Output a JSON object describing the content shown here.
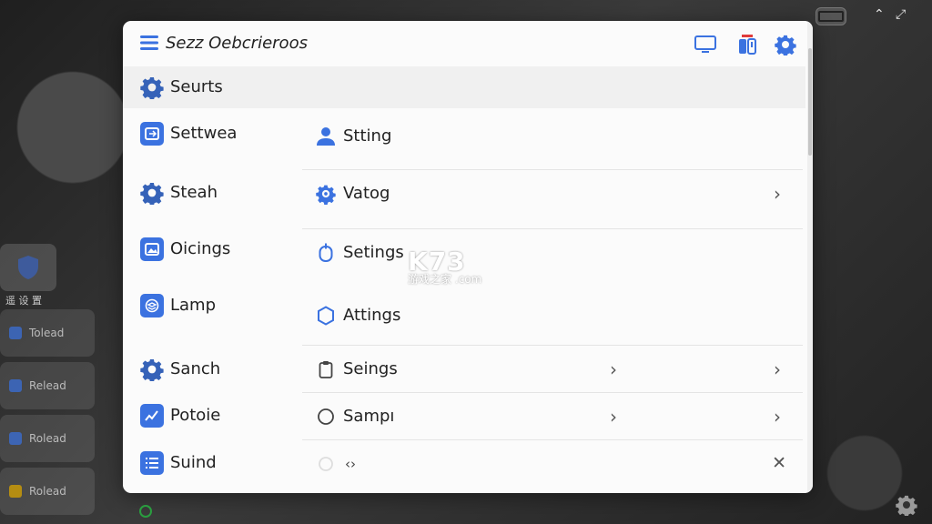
{
  "window": {
    "title": "Sezz Oebcrieroos",
    "section_label": "Seurts"
  },
  "sidebar": {
    "items": [
      {
        "label": "Settwea",
        "icon": "swap-icon"
      },
      {
        "label": "Steah",
        "icon": "gear-icon"
      },
      {
        "label": "Oicings",
        "icon": "image-icon"
      },
      {
        "label": "Lamp",
        "icon": "layers-icon"
      },
      {
        "label": "Sanch",
        "icon": "gear-icon"
      },
      {
        "label": "Potoie",
        "icon": "chart-icon"
      },
      {
        "label": "Suind",
        "icon": "list-icon"
      }
    ]
  },
  "content": {
    "rows": [
      {
        "label": "Stting",
        "icon": "user-icon"
      },
      {
        "label": "Vatog",
        "icon": "gear-bug-icon"
      },
      {
        "label": "Setings",
        "icon": "mouse-icon"
      },
      {
        "label": "Attings",
        "icon": "shield-icon"
      },
      {
        "label": "Seings",
        "icon": "clipboard-icon"
      },
      {
        "label": "Sampı",
        "icon": "circle-icon"
      },
      {
        "label": "‹›",
        "icon": "code-icon"
      }
    ]
  },
  "watermark": {
    "main": "K73",
    "sub": "游戏之家 .com"
  },
  "background": {
    "caption": "遥 设 置",
    "cards": [
      "Tolead",
      "Relead",
      "Rolead",
      "Rolead"
    ]
  },
  "colors": {
    "accent": "#3b72e0",
    "window_bg": "#fbfbfb",
    "section_bg": "#f0f0f0"
  }
}
